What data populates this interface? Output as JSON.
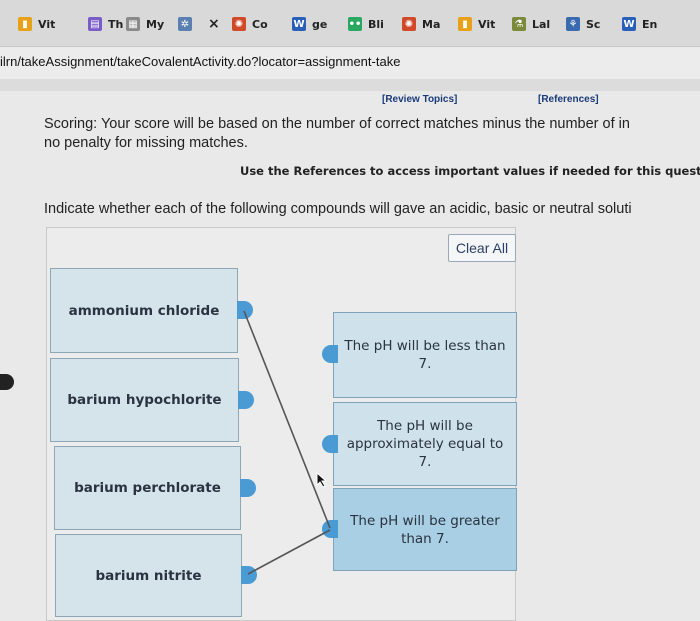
{
  "browser": {
    "tabs": [
      {
        "label": "Vit",
        "favicon": "bookmark-icon",
        "color": "#e8a21a"
      },
      {
        "label": "Th",
        "favicon": "page-icon",
        "color": "#7a5cc8"
      },
      {
        "label": "My",
        "favicon": "grid-icon",
        "color": "#8a8a8a"
      },
      {
        "label": "",
        "favicon": "molecule-icon",
        "color": "#5a7fb0"
      },
      {
        "label": "Co",
        "favicon": "gear-icon",
        "color": "#d04a2a"
      },
      {
        "label": "ge",
        "favicon": "word-icon",
        "color": "#2a5fb8"
      },
      {
        "label": "Bli",
        "favicon": "dots-icon",
        "color": "#2aa860"
      },
      {
        "label": "Ma",
        "favicon": "gear-icon",
        "color": "#d04a2a"
      },
      {
        "label": "Vit",
        "favicon": "bookmark-icon",
        "color": "#e8a21a"
      },
      {
        "label": "Lal",
        "favicon": "flask-icon",
        "color": "#7a8a3a"
      },
      {
        "label": "Sc",
        "favicon": "science-icon",
        "color": "#3a6ab0"
      },
      {
        "label": "En",
        "favicon": "word-icon",
        "color": "#2a5fb8"
      }
    ],
    "close_glyph": "×",
    "url": "ilrn/takeAssignment/takeCovalentActivity.do?locator=assignment-take"
  },
  "page": {
    "review_topics": "[Review Topics]",
    "references": "[References]",
    "scoring_line1": "Scoring: Your score will be based on the number of correct matches minus the number of in",
    "scoring_line2": "no penalty for missing matches.",
    "use_refs": "Use the References to access important values if needed for this questio",
    "question": "Indicate whether each of the following compounds will gave an acidic, basic or neutral soluti",
    "clear_all": "Clear All",
    "compounds": [
      "ammonium chloride",
      "barium hypochlorite",
      "barium perchlorate",
      "barium nitrite"
    ],
    "targets": [
      "The pH will be less than 7.",
      "The pH will be approximately equal to 7.",
      "The pH will be greater than 7."
    ],
    "matches": [
      {
        "compound": "ammonium chloride",
        "target": "The pH will be greater than 7."
      },
      {
        "compound": "barium nitrite",
        "target": "The pH will be greater than 7."
      }
    ]
  }
}
